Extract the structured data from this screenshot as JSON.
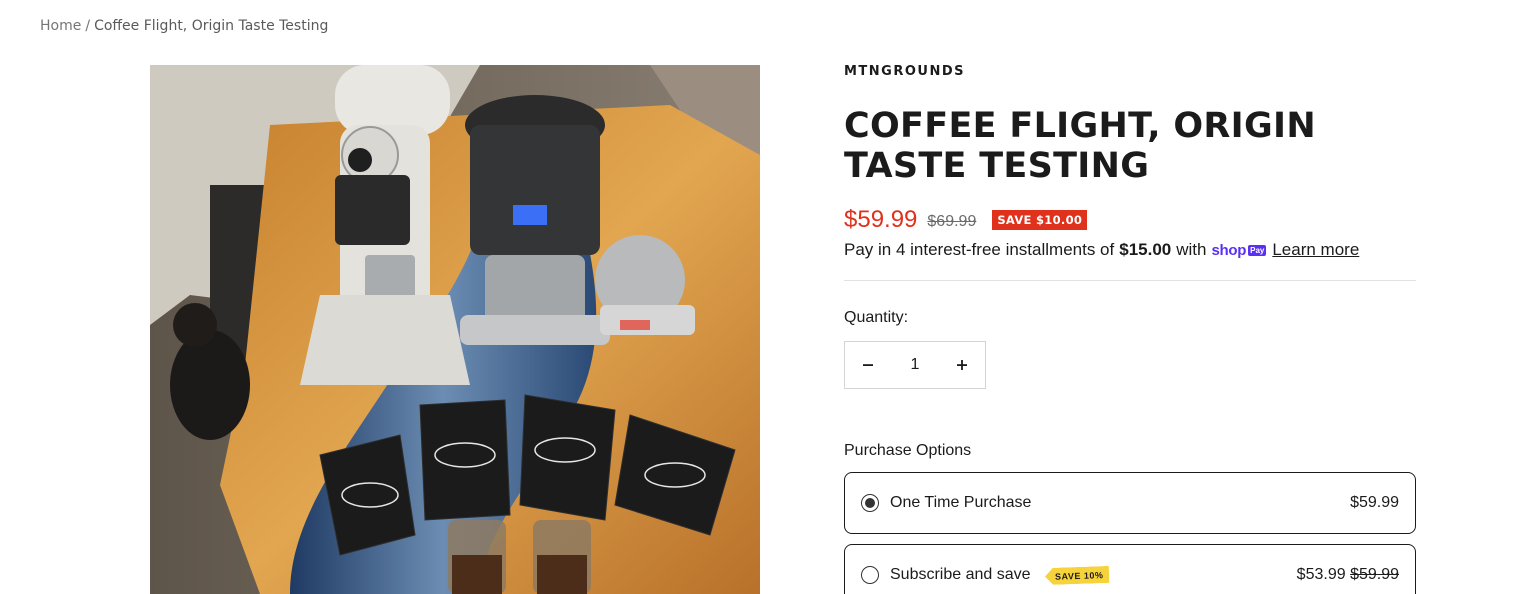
{
  "breadcrumb": {
    "home": "Home",
    "separator": "/",
    "current": "Coffee Flight, Origin Taste Testing"
  },
  "product": {
    "vendor": "MTNGROUNDS",
    "title": "Coffee Flight, Origin Taste Testing",
    "price": "$59.99",
    "compare_price": "$69.99",
    "save_badge": "SAVE $10.00",
    "installments": {
      "prefix": "Pay in 4 interest-free installments of",
      "amount": "$15.00",
      "suffix": "with",
      "shop_pay_word": "shop",
      "shop_pay_badge": "Pay",
      "learn_more": "Learn more"
    },
    "image_alt": "Coffee grinder, brewer, kettle and four coffee bags on a wood and resin table"
  },
  "quantity": {
    "label": "Quantity:",
    "value": "1",
    "decrease_icon": "minus-icon",
    "increase_icon": "plus-icon"
  },
  "purchase_options": {
    "label": "Purchase Options",
    "options": [
      {
        "label": "One Time Purchase",
        "price": "$59.99",
        "selected": true
      },
      {
        "label": "Subscribe and save",
        "tag": "SAVE 10%",
        "price": "$53.99",
        "compare_price": "$59.99",
        "selected": false
      }
    ]
  },
  "colors": {
    "sale_red": "#e0311c",
    "shop_pay_purple": "#5a31f4",
    "save_tag_yellow": "#f6d33a",
    "text": "#1c1b1b"
  }
}
